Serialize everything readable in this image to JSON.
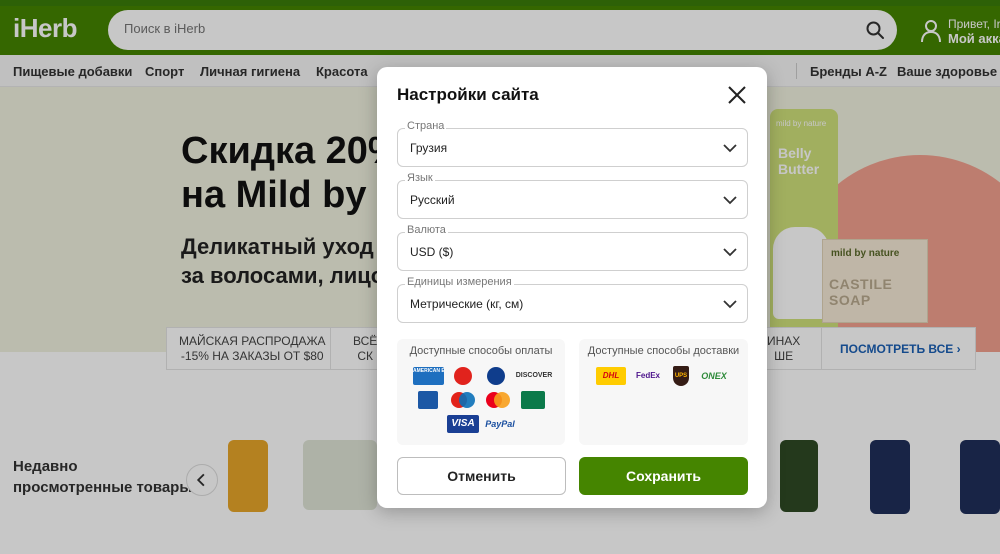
{
  "header": {
    "logo": "iHerb",
    "search_placeholder": "Поиск в iHerb",
    "account_greeting": "Привет, Ir",
    "account_label": "Мой акка"
  },
  "nav": {
    "items": [
      "Пищевые добавки",
      "Спорт",
      "Личная гигиена",
      "Красота",
      "Бренды A-Z",
      "Ваше здоровье"
    ]
  },
  "hero": {
    "title_line1": "Скидка 20%",
    "title_line2": "на Mild by Na",
    "subtitle_line1": "Деликатный уход",
    "subtitle_line2": "за волосами, лицо",
    "tube_label": "Belly Butter",
    "tube_brand": "mild by nature",
    "soap_brand": "mild by nature",
    "soap_name": "CASTILE SOAP"
  },
  "promo": {
    "cell1_line1": "МАЙСКАЯ РАСПРОДАЖА",
    "cell1_line2": "-15% НА ЗАКАЗЫ ОТ $80",
    "cell2_line1": "ВСЁ",
    "cell2_line2": "СК",
    "cell3_line1": "ИНАХ",
    "cell3_line2": "ШЕ",
    "view_all": "ПОСМОТРЕТЬ ВСЕ"
  },
  "recent": {
    "title_line1": "Недавно",
    "title_line2": "просмотренные товары"
  },
  "modal": {
    "title": "Настройки сайта",
    "country_label": "Страна",
    "country_value": "Грузия",
    "language_label": "Язык",
    "language_value": "Русский",
    "currency_label": "Валюта",
    "currency_value": "USD ($)",
    "units_label": "Единицы измерения",
    "units_value": "Метрические (кг, см)",
    "payment_title": "Доступные способы оплаты",
    "shipping_title": "Доступные способы доставки",
    "payment_logos": [
      "AMERICAN EXPRESS",
      "DISCOVER",
      "VISA",
      "PayPal"
    ],
    "shipping_logos": [
      "DHL",
      "FedEx",
      "UPS",
      "ONEX"
    ],
    "cancel_label": "Отменить",
    "save_label": "Сохранить"
  },
  "colors": {
    "brand_green": "#458500",
    "link_blue": "#1a5fb4"
  }
}
